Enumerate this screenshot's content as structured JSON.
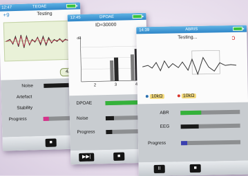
{
  "teoae": {
    "time": "12:47",
    "title": "TEOAE",
    "subtitle": "Testing",
    "freq": "+9",
    "page_badge": "4/8",
    "rows": [
      {
        "label": "Noise",
        "level": 0.75,
        "color": "#1a1a1a"
      },
      {
        "label": "Artefact",
        "level": 0.0,
        "color": "#1a1a1a"
      },
      {
        "label": "Stability",
        "level": 0.0,
        "color": "#1a1a1a"
      },
      {
        "label": "Progress",
        "level": 0.15,
        "color": "#d6328b"
      }
    ],
    "controls": {
      "stop": "■"
    }
  },
  "dpoae": {
    "time": "12:45",
    "title": "DPOAE",
    "subtitle": "ID=30000",
    "chart": {
      "ylabel": "dB",
      "categories": [
        "2",
        "3",
        "4"
      ]
    },
    "rows": [
      {
        "label": "DPOAE",
        "level": 0.85,
        "color": "#35b23a"
      },
      {
        "label": "Noise",
        "level": 0.2,
        "color": "#1a1a1a"
      },
      {
        "label": "Progress",
        "level": 0.15,
        "color": "#1a1a1a"
      }
    ],
    "controls": {
      "skip": "▶▶|",
      "stop": "■"
    }
  },
  "abris": {
    "time": "14:39",
    "title": "ABRIS",
    "subtitle": "Testing...",
    "impedance": {
      "left": "10kΩ",
      "right": "10kΩ"
    },
    "rows": [
      {
        "label": "ABR",
        "level": 0.35,
        "color": "#35b23a"
      },
      {
        "label": "EEG",
        "level": 0.3,
        "color": "#1a1a1a"
      },
      {
        "label": "Progress",
        "level": 0.1,
        "color": "#3a3fb0"
      }
    ],
    "controls": {
      "pause": "II",
      "stop": "■"
    }
  },
  "colors": {
    "header": "#2f86c8",
    "battery": "#38c23c",
    "wave_bg": "#e9f1d8"
  }
}
